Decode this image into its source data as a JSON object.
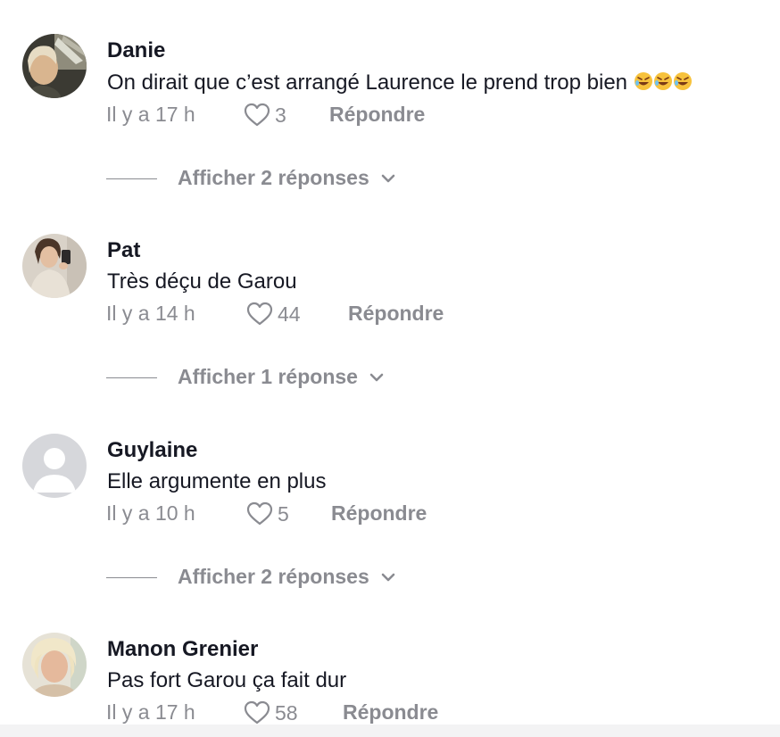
{
  "comments": [
    {
      "username": "Danie",
      "text": "On dirait que c’est arrangé Laurence le prend trop bien",
      "emoji": "🤣🤣🤣",
      "time": "Il y a 17 h",
      "likes": "3",
      "reply_label": "Répondre",
      "view_replies_label": "Afficher 2 réponses"
    },
    {
      "username": "Pat",
      "text": "Très déçu de Garou",
      "time": "Il y a 14 h",
      "likes": "44",
      "reply_label": "Répondre",
      "view_replies_label": "Afficher 1 réponse"
    },
    {
      "username": "Guylaine",
      "text": "Elle argumente en plus",
      "time": "Il y a 10 h",
      "likes": "5",
      "reply_label": "Répondre",
      "view_replies_label": "Afficher 2 réponses"
    },
    {
      "username": "Manon Grenier",
      "text": "Pas fort Garou ça fait dur",
      "time": "Il y a 17 h",
      "likes": "58",
      "reply_label": "Répondre"
    }
  ],
  "colors": {
    "text_primary": "#161823",
    "text_secondary": "#8a8b91",
    "background": "#ffffff"
  },
  "icons": {
    "like": "heart-outline-icon",
    "expand": "chevron-down-icon"
  }
}
